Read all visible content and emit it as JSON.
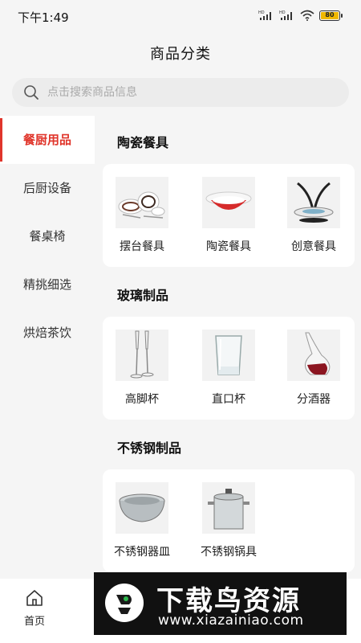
{
  "status": {
    "time": "下午1:49",
    "battery": "80",
    "signal_icons": [
      "hd-signal-icon",
      "hd-signal-icon",
      "wifi-icon"
    ]
  },
  "header": {
    "title": "商品分类"
  },
  "search": {
    "placeholder": "点击搜索商品信息"
  },
  "sidebar": {
    "items": [
      {
        "label": "餐厨用品",
        "active": true
      },
      {
        "label": "后厨设备"
      },
      {
        "label": "餐桌椅"
      },
      {
        "label": "精挑细选"
      },
      {
        "label": "烘焙茶饮"
      }
    ]
  },
  "sections": [
    {
      "title": "陶瓷餐具",
      "products": [
        "摆台餐具",
        "陶瓷餐具",
        "创意餐具"
      ]
    },
    {
      "title": "玻璃制品",
      "products": [
        "高脚杯",
        "直口杯",
        "分酒器"
      ]
    },
    {
      "title": "不锈钢制品",
      "products": [
        "不锈钢器皿",
        "不锈钢锅具"
      ]
    }
  ],
  "tabbar": {
    "home_label": "首页"
  },
  "watermark": {
    "title": "下载鸟资源",
    "url": "www.xiazainiao.com"
  },
  "colors": {
    "accent": "#e0352b",
    "background": "#f5f5f5",
    "card": "#ffffff"
  }
}
